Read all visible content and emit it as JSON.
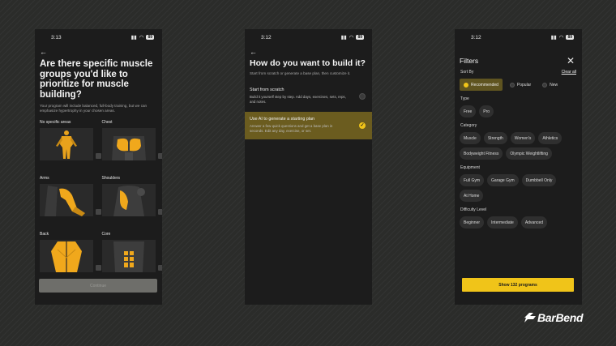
{
  "screen1": {
    "status": {
      "time": "3:13",
      "battery": "89"
    },
    "title": "Are there specific muscle groups you'd like to prioritize for muscle building?",
    "subtitle": "Your program will include balanced, full-body training, but we can emphasize hypertrophy in your chosen areas.",
    "options": [
      {
        "label": "No specific areas"
      },
      {
        "label": "Chest"
      },
      {
        "label": "Arms"
      },
      {
        "label": "Shoulders"
      },
      {
        "label": "Back"
      },
      {
        "label": "Core"
      }
    ],
    "continue_label": "Continue"
  },
  "screen2": {
    "status": {
      "time": "3:12",
      "battery": "89"
    },
    "title": "How do you want to build it?",
    "subtitle": "Start from scratch or generate a base plan, then customize it.",
    "options": [
      {
        "title": "Start from scratch",
        "desc": "Build it yourself step by step. Add days, exercises, sets, reps, and notes.",
        "selected": false
      },
      {
        "title": "Use AI to generate a starting plan",
        "desc": "Answer a few quick questions and get a base plan in seconds. Edit any day, exercise, or set.",
        "selected": true
      }
    ]
  },
  "screen3": {
    "status": {
      "time": "3:12",
      "battery": "89"
    },
    "title": "Filters",
    "sort_label": "Sort By",
    "clear_label": "Clear all",
    "sort_options": [
      "Recommended",
      "Popular",
      "New"
    ],
    "type_label": "Type",
    "type_options": [
      "Free",
      "Pro"
    ],
    "category_label": "Category",
    "category_options": [
      "Muscle",
      "Strength",
      "Women's",
      "Athletics",
      "Bodyweight Fitness",
      "Olympic Weightlifting"
    ],
    "equipment_label": "Equipment",
    "equipment_options": [
      "Full Gym",
      "Garage Gym",
      "Dumbbell Only",
      "At Home"
    ],
    "difficulty_label": "Difficulty Level",
    "difficulty_options": [
      "Beginner",
      "Intermediate",
      "Advanced"
    ],
    "show_button": "Show 132 programs"
  },
  "brand": {
    "name": "BarBend",
    "accent": "#f0c419"
  }
}
